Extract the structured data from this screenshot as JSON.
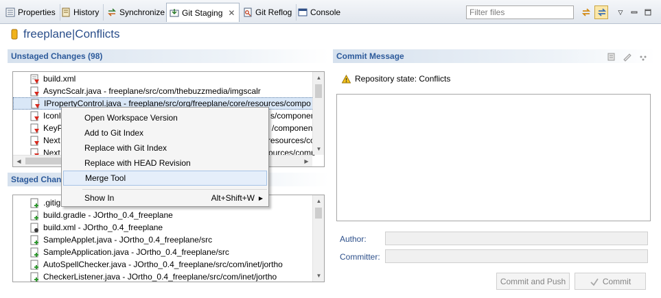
{
  "tabs": [
    {
      "label": "Properties",
      "icon": "properties-icon"
    },
    {
      "label": "History",
      "icon": "history-icon"
    },
    {
      "label": "Synchronize",
      "icon": "synchronize-icon"
    },
    {
      "label": "Git Staging",
      "icon": "git-staging-icon",
      "active": true
    },
    {
      "label": "Git Reflog",
      "icon": "git-reflog-icon"
    },
    {
      "label": "Console",
      "icon": "console-icon"
    }
  ],
  "filter": {
    "placeholder": "Filter files"
  },
  "title": "freeplane|Conflicts",
  "unstaged": {
    "header": "Unstaged Changes (98)",
    "items": [
      {
        "text": "build.xml",
        "icon": "conflict-file-icon"
      },
      {
        "text": "AsyncScalr.java - freeplane/src/com/thebuzzmedia/imgscalr",
        "icon": "conflict-file-icon"
      },
      {
        "text": "IPropertyControl.java - freeplane/src/org/freeplane/core/resources/compo",
        "icon": "conflict-file-icon",
        "selected": true
      },
      {
        "text": "IconI",
        "tail": "s/componen",
        "icon": "conflict-file-icon"
      },
      {
        "text": "KeyP",
        "tail": "/componen",
        "icon": "conflict-file-icon"
      },
      {
        "text": "Next",
        "tail": "resources/co",
        "icon": "conflict-file-icon"
      },
      {
        "text": "Next",
        "tail": "ources/comp",
        "icon": "conflict-file-icon"
      }
    ]
  },
  "staged": {
    "header": "Staged Changes",
    "items": [
      {
        "text": ".gitig",
        "icon": "added-file-icon"
      },
      {
        "text": "build.gradle - JOrtho_0.4_freeplane",
        "icon": "added-file-icon"
      },
      {
        "text": "build.xml - JOrtho_0.4_freeplane",
        "icon": "modified-xml-icon"
      },
      {
        "text": "SampleApplet.java - JOrtho_0.4_freeplane/src",
        "icon": "added-file-icon"
      },
      {
        "text": "SampleApplication.java - JOrtho_0.4_freeplane/src",
        "icon": "added-file-icon"
      },
      {
        "text": "AutoSpellChecker.java - JOrtho_0.4_freeplane/src/com/inet/jortho",
        "icon": "added-file-icon"
      },
      {
        "text": "CheckerListener.java - JOrtho_0.4_freeplane/src/com/inet/jortho",
        "icon": "added-file-icon"
      }
    ]
  },
  "context_menu": {
    "items": [
      {
        "label": "Open Workspace Version"
      },
      {
        "label": "Add to Git Index"
      },
      {
        "label": "Replace with Git Index"
      },
      {
        "label": "Replace with HEAD Revision"
      },
      {
        "label": "Merge Tool",
        "highlighted": true
      },
      {
        "label": "Show In",
        "accelerator": "Alt+Shift+W",
        "submenu": true
      }
    ]
  },
  "commit": {
    "header": "Commit Message",
    "repository_state": "Repository state: Conflicts",
    "message": "",
    "author_label": "Author:",
    "author_value": "",
    "committer_label": "Committer:",
    "committer_value": "",
    "commit_and_push_label": "Commit and Push",
    "commit_label": "Commit"
  },
  "colors": {
    "section_header_text": "#2c5a9b",
    "title_text": "#2a4e8a",
    "conflict_red": "#d8281c",
    "selection": "#d9e7f7",
    "menu_highlight": "#e5eefa"
  }
}
